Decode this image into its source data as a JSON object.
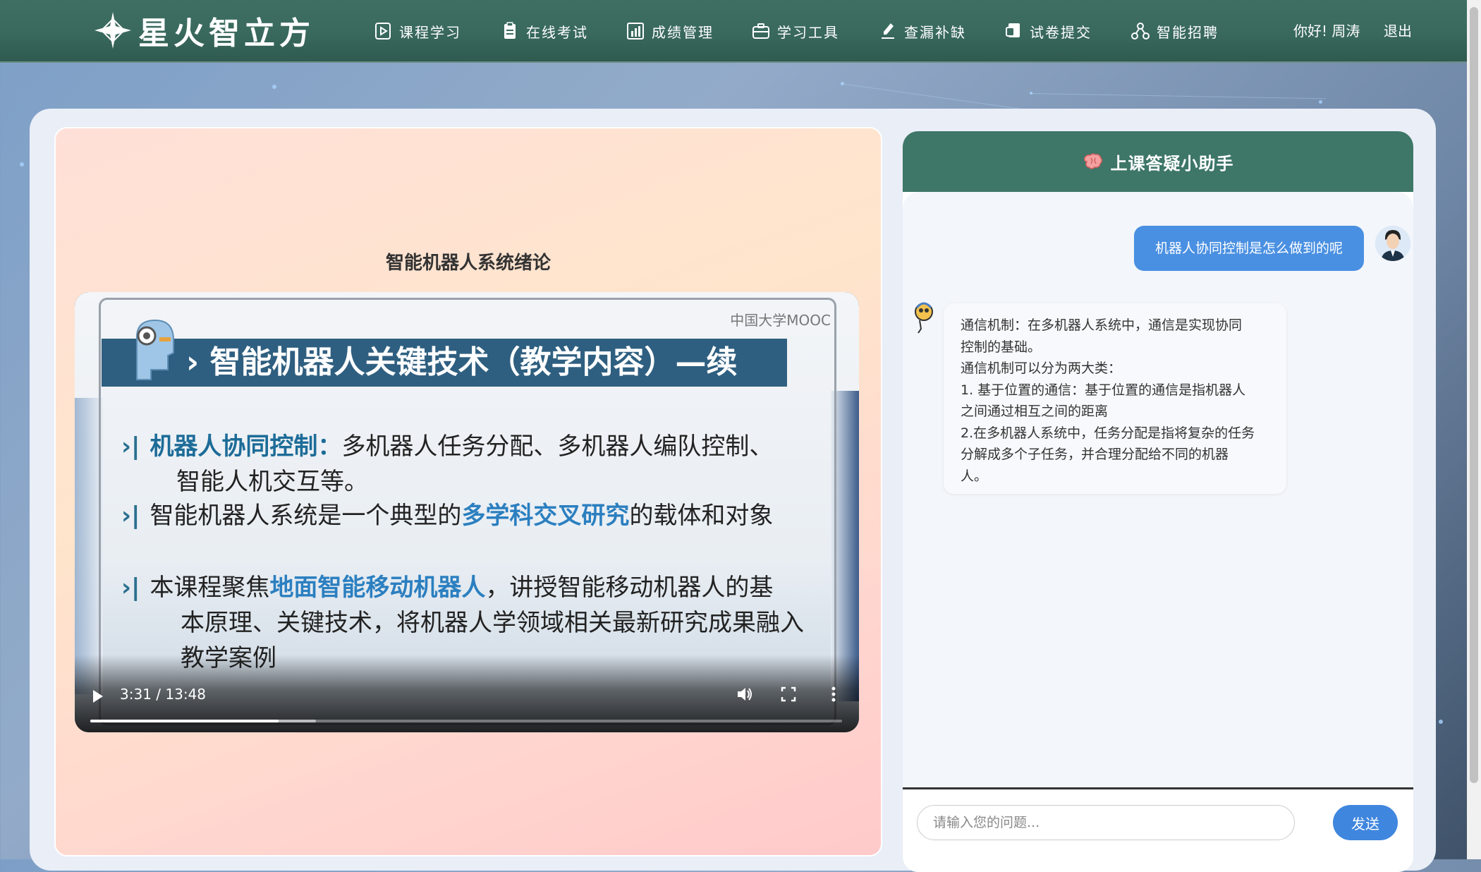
{
  "app": {
    "title": "星火智立方"
  },
  "nav": {
    "items": [
      {
        "label": "课程学习",
        "icon": "play-square-icon"
      },
      {
        "label": "在线考试",
        "icon": "clipboard-icon"
      },
      {
        "label": "成绩管理",
        "icon": "bar-chart-icon"
      },
      {
        "label": "学习工具",
        "icon": "toolbox-icon"
      },
      {
        "label": "查漏补缺",
        "icon": "pen-icon"
      },
      {
        "label": "试卷提交",
        "icon": "upload-doc-icon"
      },
      {
        "label": "智能招聘",
        "icon": "network-icon"
      }
    ],
    "greeting": "你好! 周涛",
    "logout": "退出"
  },
  "video": {
    "title": "智能机器人系统绪论",
    "watermark": "中国大学MOOC",
    "slide": {
      "heading": "智能机器人关键技术（教学内容）—续",
      "b1_highlight": "机器人协同控制：",
      "b1_rest_line1": "多机器人任务分配、多机器人编队控制、",
      "b1_line2": "智能人机交互等。",
      "b2_pre": "智能机器人系统是一个典型的",
      "b2_highlight": "多学科交叉研究",
      "b2_post": "的载体和对象",
      "b3_pre": "本课程聚焦",
      "b3_highlight": "地面智能移动机器人",
      "b3_post_line1": "，讲授智能移动机器人的基",
      "b3_line2": "本原理、关键技术，将机器人学领域相关最新研究成果融入",
      "b3_line3": "教学案例"
    },
    "current_time": "3:31 / 13:48",
    "progress": 0.25,
    "buffered": 0.3
  },
  "chat": {
    "header": "上课答疑小助手",
    "user_message": "机器人协同控制是怎么做到的呢",
    "bot_lines": [
      "通信机制：在多机器人系统中，通信是实现协同",
      "控制的基础。",
      "通信机制可以分为两大类：",
      "1. 基于位置的通信：基于位置的通信是指机器人",
      "之间通过相互之间的距离",
      "2.在多机器人系统中，任务分配是指将复杂的任务",
      "分解成多个子任务，并合理分配给不同的机器",
      "人。"
    ],
    "input_placeholder": "请输入您的问题...",
    "send_label": "发送"
  }
}
